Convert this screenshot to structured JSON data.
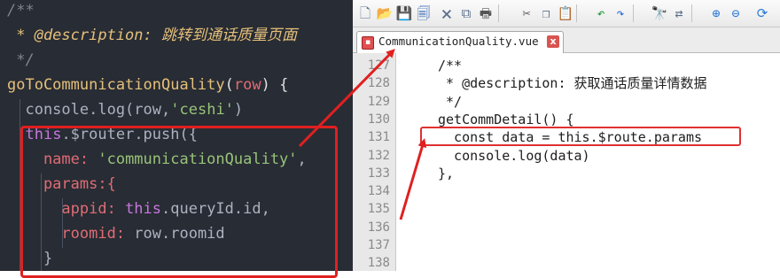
{
  "left_code": {
    "lines": [
      {
        "text": "/**",
        "style": "comment"
      },
      {
        "text": " * @description: 跳转到通话质量页面",
        "style": "doc"
      },
      {
        "text": " */",
        "style": "comment"
      },
      {
        "parts": [
          [
            "goToCommunicationQuality",
            "func"
          ],
          [
            "(",
            "punc"
          ],
          [
            "row",
            "param"
          ],
          [
            ") {",
            "punc"
          ]
        ]
      },
      {
        "parts": [
          [
            "  console.log(",
            "plain"
          ],
          [
            "row",
            "plain"
          ],
          [
            ",",
            "plain"
          ],
          [
            "'ceshi'",
            "str"
          ],
          [
            ")",
            "plain"
          ]
        ]
      },
      {
        "parts": [
          [
            "  ",
            "plain"
          ],
          [
            "this",
            "this"
          ],
          [
            ".$router.push({",
            "plain"
          ]
        ]
      },
      {
        "parts": [
          [
            "    name: ",
            "prop"
          ],
          [
            "'communicationQuality'",
            "str"
          ],
          [
            ",",
            "plain"
          ]
        ]
      },
      {
        "parts": [
          [
            "    params:{",
            "prop"
          ]
        ]
      },
      {
        "parts": [
          [
            "      appid: ",
            "prop"
          ],
          [
            "this",
            "this"
          ],
          [
            ".queryId.id,",
            "plain"
          ]
        ]
      },
      {
        "parts": [
          [
            "      roomid: ",
            "prop"
          ],
          [
            "row.roomid",
            "plain"
          ]
        ]
      },
      {
        "parts": [
          [
            "    }",
            "plain"
          ]
        ]
      }
    ]
  },
  "toolbar": {
    "icons": [
      "new-file-icon",
      "open-file-icon",
      "save-icon",
      "save-all-icon",
      "close-icon",
      "close-all-icon",
      "print-icon",
      "cut-icon",
      "copy-icon",
      "paste-icon",
      "undo-icon",
      "redo-icon",
      "find-icon",
      "replace-icon",
      "zoom-in-icon",
      "zoom-out-icon",
      "sync-icon"
    ]
  },
  "tab": {
    "label": "CommunicationQuality.vue",
    "close": "x"
  },
  "editor": {
    "line_numbers": [
      "127",
      "128",
      "129",
      "130",
      "131",
      "132",
      "133",
      "134",
      "135",
      "136",
      "137",
      "138"
    ],
    "lines": [
      "/**",
      " * @description: 获取通话质量详情数据",
      " */",
      "getCommDetail() {",
      "  const data = this.$route.params",
      "  console.log(data)",
      "},",
      "",
      "",
      "",
      "",
      ""
    ]
  },
  "colors": {
    "left_bg": "#282c34",
    "annotation_red": "#e02020"
  }
}
